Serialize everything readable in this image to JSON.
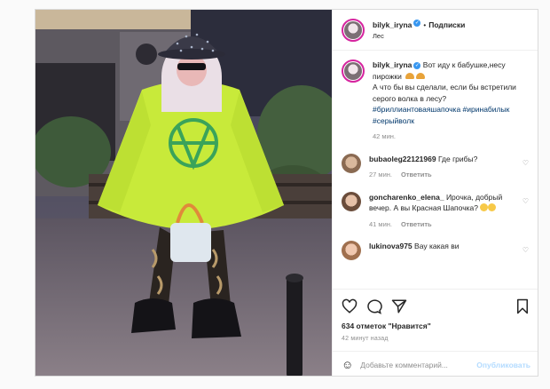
{
  "header": {
    "username": "bilyk_iryna",
    "verified_icon": "verified-badge-icon",
    "dot": "•",
    "follow_label": "Подписки",
    "location": "Лес"
  },
  "caption": {
    "username": "bilyk_iryna",
    "text_part1": "Вот иду к бабушке,несу пирожки",
    "text_part2": "А что бы вы сделали, если бы встретили серого волка в лесу?",
    "hashtags": "#бриллиантоваяшапочка #иринабилык #серыйволк",
    "time": "42 мин."
  },
  "comments": [
    {
      "username": "bubaoleg22121969",
      "text": "Где грибы?",
      "time": "27 мин.",
      "reply": "Ответить"
    },
    {
      "username": "goncharenko_elena_",
      "text": "Ирочка, добрый вечер. А вы Красная Шапочка?",
      "time": "41 мин.",
      "reply": "Ответить"
    },
    {
      "username": "lukinova975",
      "text": "Вау какая ви"
    }
  ],
  "actions": {
    "likes": "634 отметок \"Нравится\"",
    "ago": "42 минут назад"
  },
  "add_comment": {
    "placeholder": "Добавьте комментарий...",
    "publish_label": "Опубликовать"
  },
  "colors": {
    "accent": "#3897f0",
    "publish_disabled": "#b3dbff",
    "hoodie": "#c8ea3a",
    "hoodie_print": "#3aa35a"
  }
}
